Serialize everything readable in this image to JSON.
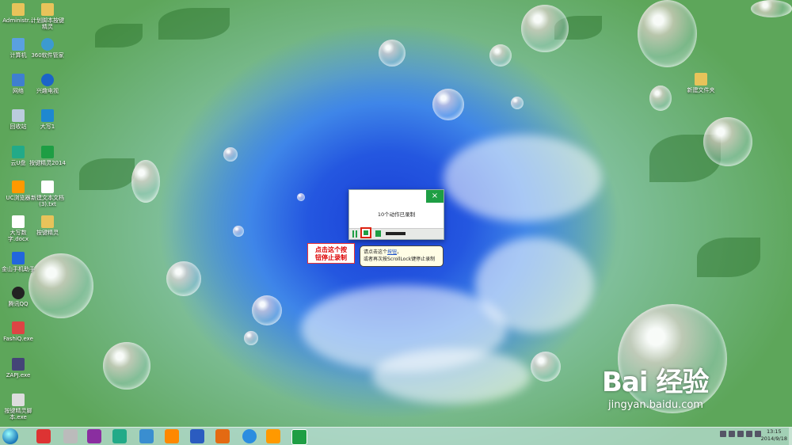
{
  "desktop_icons": [
    {
      "label": "Administr...",
      "name": "folder-admin-icon"
    },
    {
      "label": "计算机",
      "name": "computer-icon"
    },
    {
      "label": "网络",
      "name": "network-icon"
    },
    {
      "label": "回收站",
      "name": "recycle-bin-icon"
    },
    {
      "label": "云U盘",
      "name": "cloud-drive-icon"
    },
    {
      "label": "UC浏览器",
      "name": "uc-browser-icon"
    },
    {
      "label": "大写数字.docx",
      "name": "docx-icon"
    },
    {
      "label": "金山手机助手",
      "name": "phone-assistant-icon"
    },
    {
      "label": "腾讯QQ",
      "name": "qq-icon"
    },
    {
      "label": "FashiQ.exe",
      "name": "exe-icon"
    },
    {
      "label": "ZAPJ.exe",
      "name": "exe2-icon"
    },
    {
      "label": "按键精灵脚本.exe",
      "name": "script-exe-icon"
    },
    {
      "label": "计划脚本按键精灵",
      "name": "folder2-icon"
    },
    {
      "label": "360软件管家",
      "name": "softmgr-icon"
    },
    {
      "label": "兴趣电视",
      "name": "tv-icon"
    },
    {
      "label": "大写1",
      "name": "app-icon"
    },
    {
      "label": "按键精灵2014",
      "name": "keysprite-icon"
    },
    {
      "label": "新建文本文档(3).txt",
      "name": "txt-icon"
    },
    {
      "label": "按键精灵",
      "name": "folder3-icon"
    },
    {
      "label": "新建文件夹",
      "name": "new-folder-icon"
    }
  ],
  "dialog": {
    "close": "×",
    "message": "10个动作已录制"
  },
  "callout": {
    "line1": "点击这个按",
    "line2": "钮停止录制"
  },
  "tooltip": {
    "prefix": "请点击这个",
    "link": "按钮",
    "suffix": "，",
    "line2": "或者再次按ScrollLock键停止录制"
  },
  "watermark": {
    "brand": "Bai 经验",
    "url": "jingyan.baidu.com"
  },
  "taskbar": {
    "time": "13:15",
    "date": "2014/9/18"
  },
  "colors": {
    "accent": "#1e9e44",
    "callout_border": "#e33333"
  }
}
